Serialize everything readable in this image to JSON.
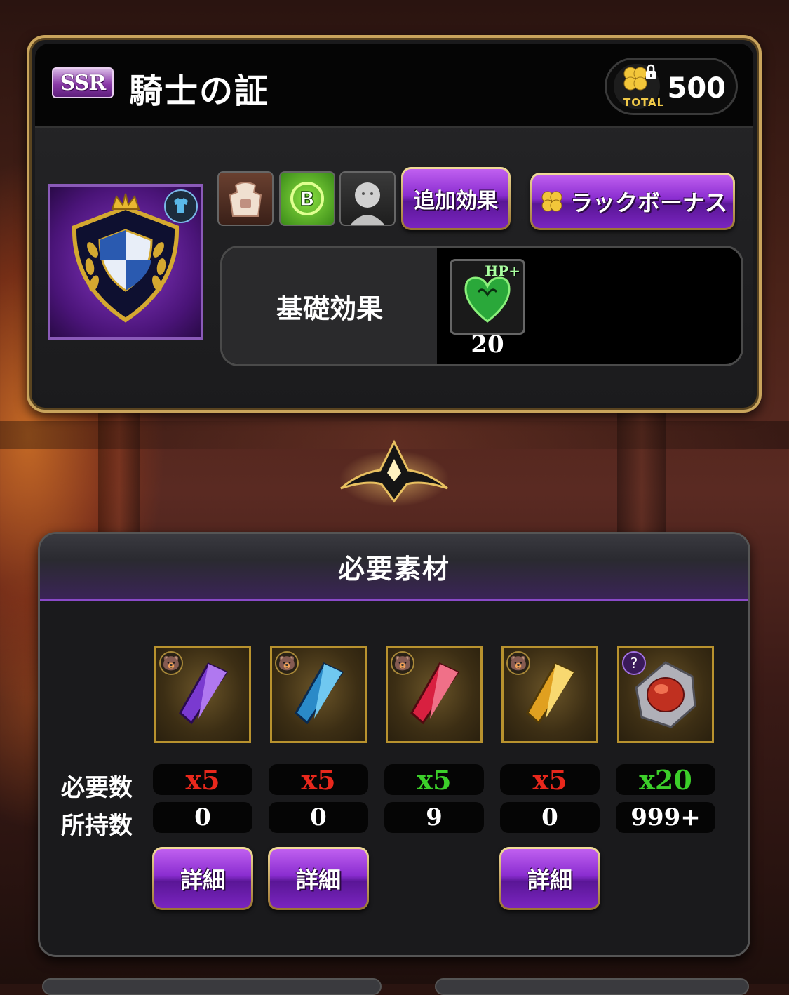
{
  "item": {
    "rarity": "SSR",
    "name": "騎士の証",
    "total_label": "TOTAL",
    "total_value": "500"
  },
  "buttons": {
    "additional_effect": "追加効果",
    "luck_bonus": "ラックボーナス"
  },
  "base_effect": {
    "label": "基礎効果",
    "stat_label": "HP+",
    "value": "20"
  },
  "materials": {
    "title": "必要素材",
    "required_label": "必要数",
    "owned_label": "所持数",
    "detail_label": "詳細",
    "items": [
      {
        "name": "purple-crystal",
        "required": "x5",
        "owned": "0",
        "status": "insufficient",
        "color": "#7a3ad0",
        "mark": "bear",
        "has_detail": true
      },
      {
        "name": "blue-crystal",
        "required": "x5",
        "owned": "0",
        "status": "insufficient",
        "color": "#2a8ac8",
        "mark": "bear",
        "has_detail": true
      },
      {
        "name": "red-crystal",
        "required": "x5",
        "owned": "9",
        "status": "sufficient",
        "color": "#d82040",
        "mark": "bear",
        "has_detail": false
      },
      {
        "name": "yellow-crystal",
        "required": "x5",
        "owned": "0",
        "status": "insufficient",
        "color": "#e0a020",
        "mark": "bear",
        "has_detail": true
      },
      {
        "name": "red-gem",
        "required": "x20",
        "owned": "999+",
        "status": "sufficient",
        "color": "#c03020",
        "mark": "?",
        "has_detail": false
      }
    ]
  },
  "colors": {
    "gold_border": "#c9a45c",
    "purple_button": "#8a2dd0",
    "insufficient": "#e8281c",
    "sufficient": "#3ccf2a"
  }
}
